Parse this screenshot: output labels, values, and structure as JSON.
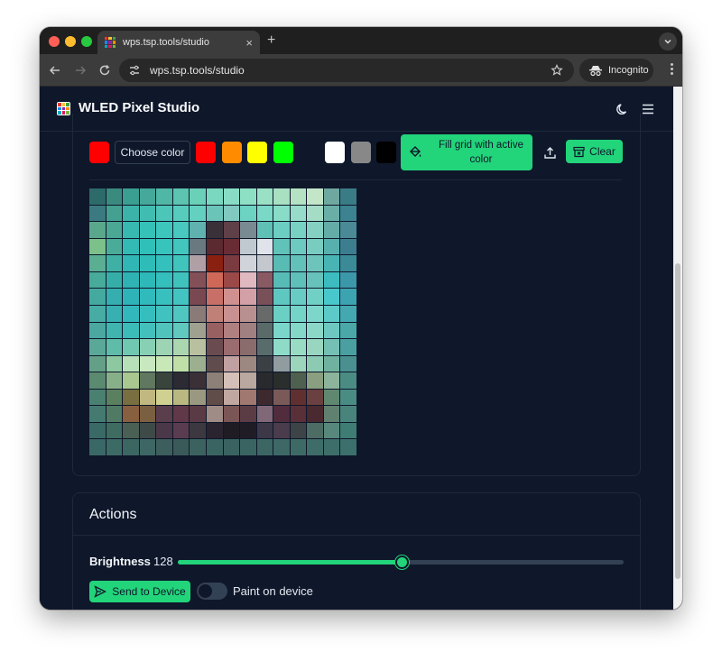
{
  "browser": {
    "tab_title": "wps.tsp.tools/studio",
    "url": "wps.tsp.tools/studio",
    "incognito_label": "Incognito",
    "new_tab_icon": "+",
    "close_icon": "×"
  },
  "app": {
    "title": "WLED Pixel Studio"
  },
  "palette": {
    "active_color": "#ff0000",
    "choose_label": "Choose color",
    "swatches": [
      "#ff0000",
      "#ff8c00",
      "#ffff00",
      "#00ff00",
      "#0f172a",
      "#ffffff",
      "#888888",
      "#000000"
    ],
    "fill_label": "Fill grid with active color",
    "clear_label": "Clear"
  },
  "grid": {
    "size": 16,
    "pixels": [
      [
        "#2d6a6a",
        "#3b8a80",
        "#3a9e90",
        "#45a89a",
        "#50b6a5",
        "#5cc4b0",
        "#6bd0b8",
        "#7bd8c0",
        "#88dcc5",
        "#8ee0c5",
        "#9ae0c5",
        "#a9e0c2",
        "#b5e2c2",
        "#c4e6c8",
        "#6fa8a0",
        "#3a7c86"
      ],
      [
        "#3a7a80",
        "#44a090",
        "#3bb3a8",
        "#40bdb0",
        "#4bc6b8",
        "#57ccbc",
        "#64d0c0",
        "#6bc4b8",
        "#80c8c0",
        "#6cd2c2",
        "#7ad8c6",
        "#88dcc8",
        "#96dcc8",
        "#a5dcc6",
        "#6aaea8",
        "#3c8290"
      ],
      [
        "#5aa88c",
        "#4aa894",
        "#37b8b0",
        "#35c0b8",
        "#3cc6bc",
        "#48c8be",
        "#60b2b0",
        "#3a3038",
        "#604048",
        "#7a8a92",
        "#5fc0b6",
        "#6ccec2",
        "#78d2c4",
        "#84d0c2",
        "#64aca8",
        "#4a8a96"
      ],
      [
        "#7cc08a",
        "#4aac98",
        "#33bab4",
        "#30c0ba",
        "#36c4bc",
        "#42c6be",
        "#6a7880",
        "#5a2a30",
        "#6a2c34",
        "#c0c8d0",
        "#e0e4ea",
        "#60c2b8",
        "#6ccac0",
        "#78ccc0",
        "#58b0ae",
        "#3c7e90"
      ],
      [
        "#5aae92",
        "#3eb0a4",
        "#30b6b4",
        "#2ebcb8",
        "#34c0bc",
        "#40c4bc",
        "#b0a0a6",
        "#8a2010",
        "#7a3a40",
        "#d0d4da",
        "#c4c8ce",
        "#58bcb4",
        "#62c2ba",
        "#6cc4ba",
        "#48b4b4",
        "#3a8a98"
      ],
      [
        "#48aa9a",
        "#36aea8",
        "#2eb2b4",
        "#2eb8b8",
        "#34bebc",
        "#40c2bc",
        "#845058",
        "#d06858",
        "#9a4848",
        "#e0b8c0",
        "#8a5a62",
        "#58bcb6",
        "#5fc0ba",
        "#66c2ba",
        "#3cbcbe",
        "#3c98a8"
      ],
      [
        "#44aaa0",
        "#34aeae",
        "#2eb4b8",
        "#30babc",
        "#38c0be",
        "#44c4c0",
        "#7a4850",
        "#c87068",
        "#d09090",
        "#d4a0a8",
        "#7a5058",
        "#5ec8c0",
        "#68ccc4",
        "#70d0c6",
        "#48c8cc",
        "#3ca4b0"
      ],
      [
        "#46aca4",
        "#36b0b0",
        "#32b8bc",
        "#36bebe",
        "#40c2c0",
        "#50c6c0",
        "#8a7a78",
        "#c08078",
        "#c89090",
        "#b89090",
        "#686a6a",
        "#6ad0c4",
        "#74d4c8",
        "#7cd6ca",
        "#5ccac8",
        "#44a8b0"
      ],
      [
        "#4aa8a0",
        "#40b4ae",
        "#3cbcb8",
        "#44c0bc",
        "#50c4bc",
        "#60c8be",
        "#a0a090",
        "#986060",
        "#b08080",
        "#a08080",
        "#5a6a68",
        "#7ad6c8",
        "#84d8c8",
        "#8cd8c8",
        "#6cc8c0",
        "#4aa8a8"
      ],
      [
        "#5aa898",
        "#5ebca8",
        "#70c8b0",
        "#88d0b4",
        "#9cd4b4",
        "#acd6b0",
        "#b8c0a0",
        "#6a4c50",
        "#9a6c70",
        "#8a6c6c",
        "#586c6c",
        "#8edcc8",
        "#98dcc4",
        "#98d6c0",
        "#74c0b4",
        "#4aa0a0"
      ],
      [
        "#64a088",
        "#8cc8a0",
        "#b8e0b8",
        "#c8e8c0",
        "#c8e8b8",
        "#c0e0a8",
        "#9cb090",
        "#604c4c",
        "#c0a0a0",
        "#9c8880",
        "#3a4044",
        "#909ca0",
        "#9cd4bc",
        "#8ccab4",
        "#70b2a0",
        "#4a9090"
      ],
      [
        "#5a8a70",
        "#88b088",
        "#a8c890",
        "#607860",
        "#38443c",
        "#2c2a32",
        "#3a3036",
        "#8c8078",
        "#d4c0b8",
        "#b8a8a0",
        "#282a2e",
        "#2a2e2c",
        "#506050",
        "#8a9e80",
        "#8cb49c",
        "#4a8c84"
      ],
      [
        "#4a8070",
        "#5a8060",
        "#786e40",
        "#c0b880",
        "#d0d090",
        "#b8b880",
        "#9a9880",
        "#604c48",
        "#c0a8a0",
        "#a07870",
        "#3c2a2e",
        "#7a5a58",
        "#603030",
        "#6a4040",
        "#608870",
        "#4a8c84"
      ],
      [
        "#447a70",
        "#507a64",
        "#886040",
        "#7a6040",
        "#5a3e4c",
        "#603848",
        "#5a3a44",
        "#a08c86",
        "#7a5656",
        "#5c3c44",
        "#806878",
        "#502c3c",
        "#5a3038",
        "#4a2a30",
        "#608070",
        "#48847c"
      ],
      [
        "#3a6a66",
        "#3e6c60",
        "#4a6054",
        "#3e4a48",
        "#4a3848",
        "#5a3c50",
        "#3c3840",
        "#2a2430",
        "#201c24",
        "#201c26",
        "#3c3848",
        "#4a3c4c",
        "#3c4448",
        "#4c6c64",
        "#58887c",
        "#3e7c74"
      ],
      [
        "#3a6866",
        "#3c6a64",
        "#3c6662",
        "#3e6664",
        "#3c5e5c",
        "#3a5a5a",
        "#3c6260",
        "#3a6462",
        "#3a6260",
        "#3a6462",
        "#3c6664",
        "#3e6866",
        "#3e6a66",
        "#3e6c68",
        "#3e6e6a",
        "#3c706c"
      ]
    ]
  },
  "actions": {
    "title": "Actions",
    "brightness_label": "Brightness",
    "brightness_value": "128",
    "brightness_fraction": 0.502,
    "send_label": "Send to Device",
    "paint_label": "Paint on device",
    "paint_enabled": false
  }
}
